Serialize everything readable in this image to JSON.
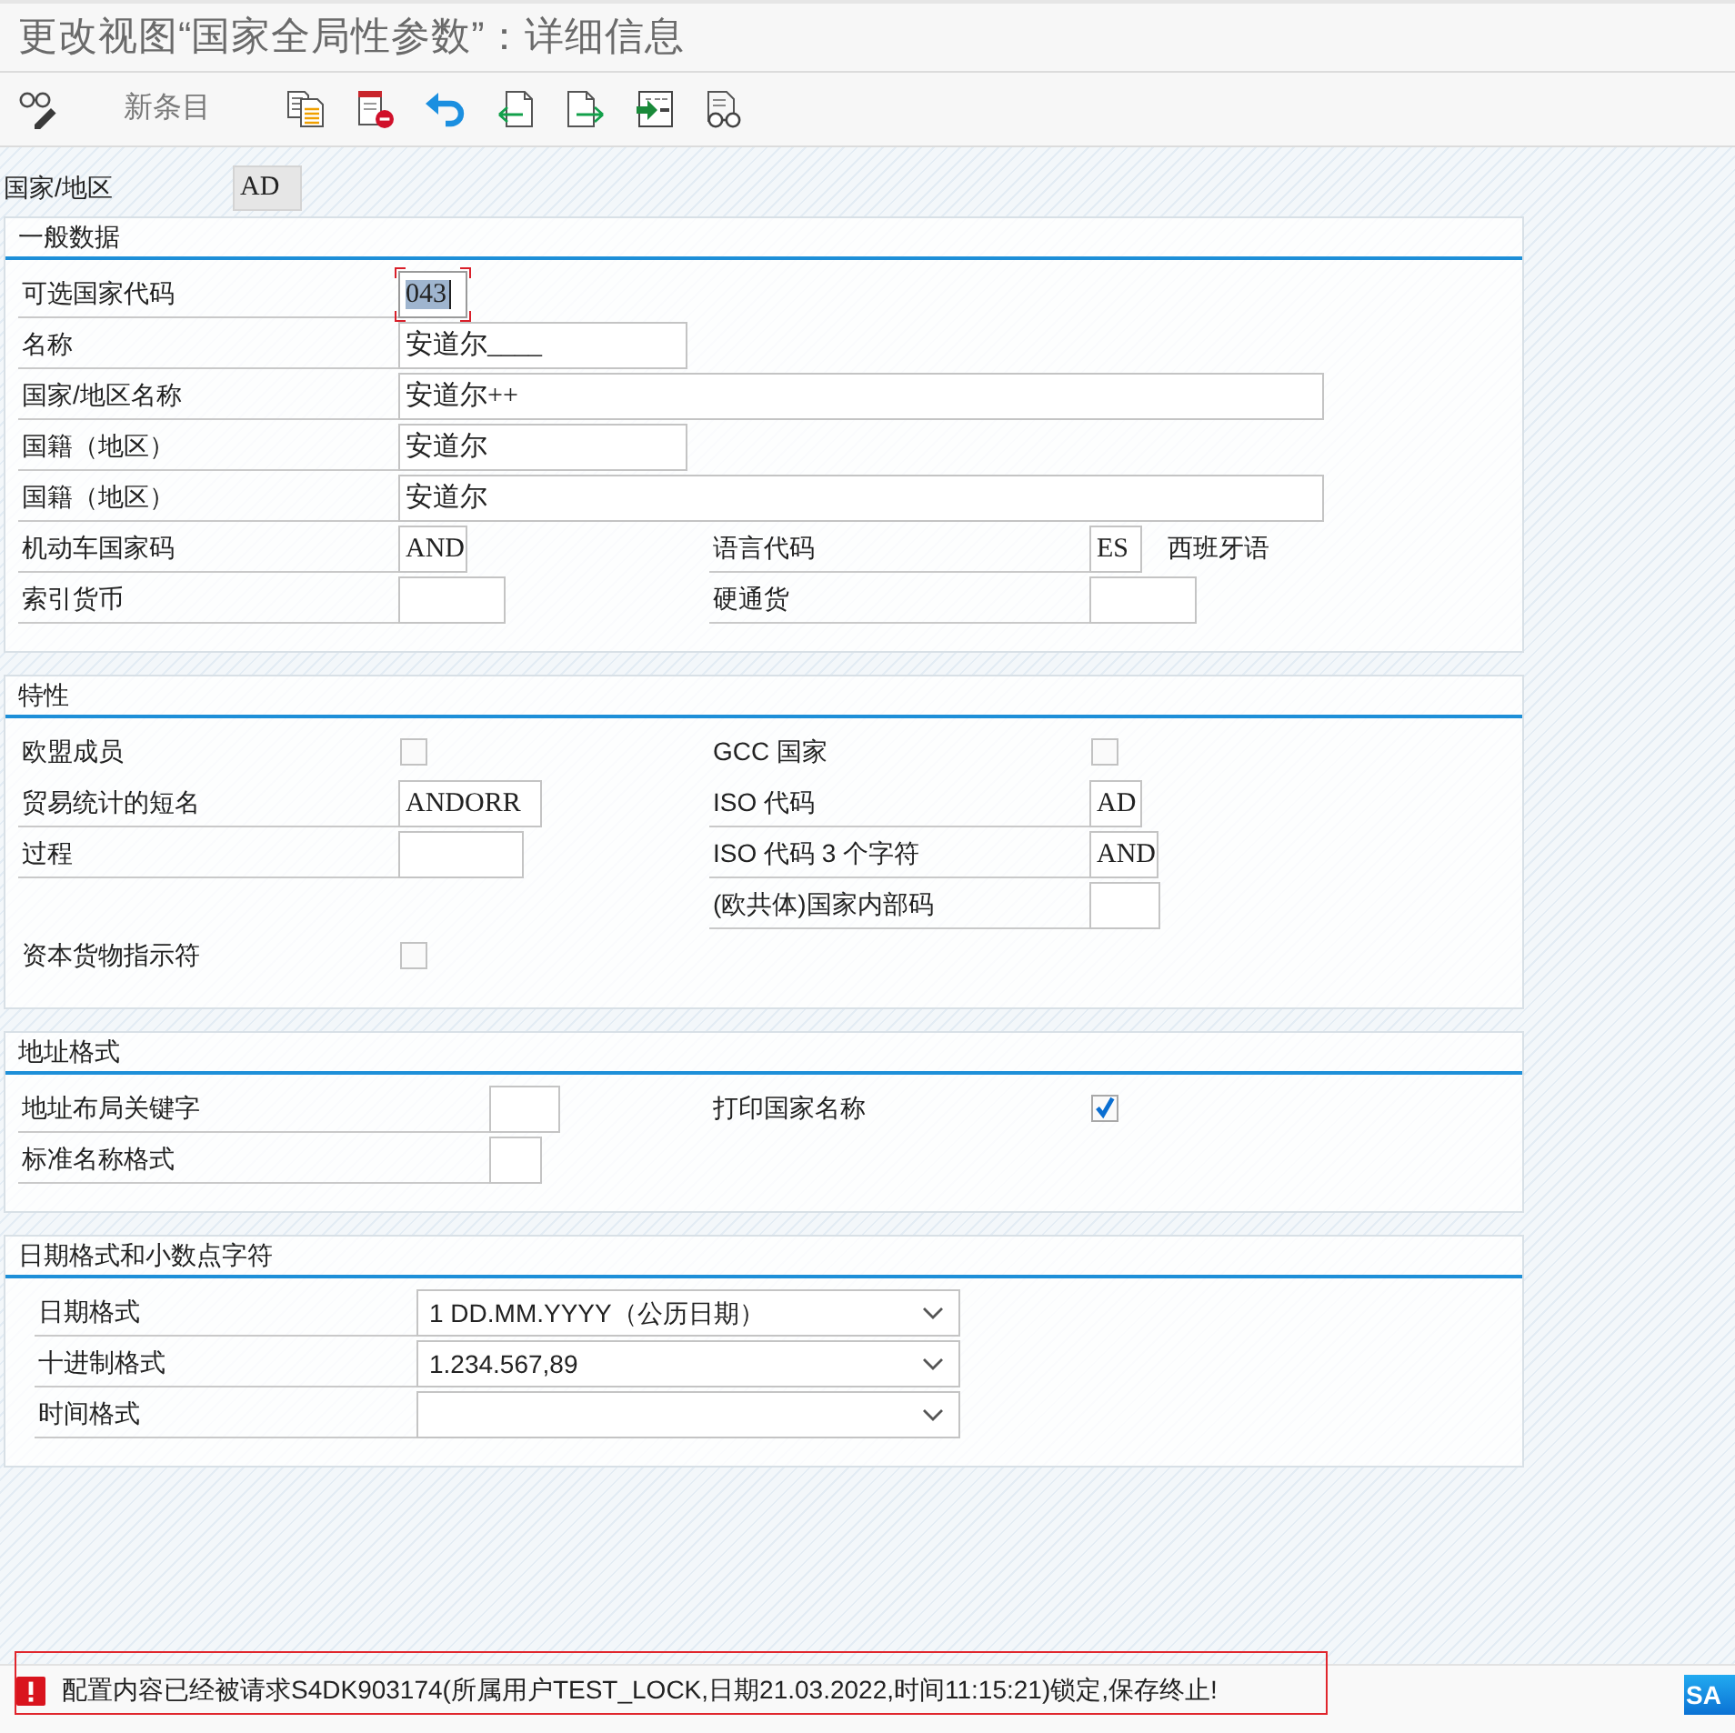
{
  "window": {
    "title": "更改视图“国家全局性参数”：详细信息"
  },
  "toolbar": {
    "new_entries": "新条目"
  },
  "key_field": {
    "label": "国家/地区",
    "value": "AD"
  },
  "groups": [
    {
      "title": "一般数据",
      "rows": [
        {
          "left": {
            "label": "可选国家代码",
            "kind": "input",
            "value": "043",
            "focused": true
          }
        },
        {
          "left": {
            "label": "名称",
            "kind": "input",
            "value": "安道尔____",
            "focused": false
          }
        },
        {
          "left": {
            "label": "国家/地区名称",
            "kind": "input",
            "value": "安道尔++",
            "focused": false
          }
        },
        {
          "left": {
            "label": "国籍（地区）",
            "kind": "input",
            "value": "安道尔",
            "focused": false
          }
        },
        {
          "left": {
            "label": "国籍（地区）",
            "kind": "input",
            "value": "安道尔",
            "focused": false
          }
        },
        {
          "left": {
            "label": "机动车国家码",
            "kind": "input",
            "value": "AND",
            "focused": false
          },
          "right": {
            "label": "语言代码",
            "kind": "input",
            "value": "ES",
            "focused": false,
            "description": "西班牙语"
          }
        },
        {
          "left": {
            "label": "索引货币",
            "kind": "input",
            "focused": false
          },
          "right": {
            "label": "硬通货",
            "kind": "input",
            "focused": false
          }
        }
      ]
    },
    {
      "title": "特性",
      "rows": [
        {
          "left": {
            "label": "欧盟成员",
            "kind": "checkbox",
            "checked": false
          },
          "right": {
            "label": "GCC 国家",
            "kind": "checkbox",
            "checked": false
          }
        },
        {
          "left": {
            "label": "贸易统计的短名",
            "kind": "input",
            "value": "ANDORR",
            "focused": false
          },
          "right": {
            "label": "ISO 代码",
            "kind": "input",
            "value": "AD",
            "focused": false
          }
        },
        {
          "left": {
            "label": "过程",
            "kind": "input",
            "focused": false
          },
          "right": {
            "label": "ISO 代码 3 个字符",
            "kind": "input",
            "value": "AND",
            "focused": false
          }
        },
        {
          "right": {
            "label": "(欧共体)国家内部码",
            "kind": "input",
            "focused": false
          }
        },
        {
          "left": {
            "label": "资本货物指示符",
            "kind": "checkbox",
            "checked": false
          }
        }
      ]
    },
    {
      "title": "地址格式",
      "rows": [
        {
          "left": {
            "label": "地址布局关键字",
            "kind": "input",
            "focused": false
          },
          "right": {
            "label": "打印国家名称",
            "kind": "checkbox",
            "checked": true
          }
        },
        {
          "left": {
            "label": "标准名称格式",
            "kind": "input",
            "focused": false
          }
        }
      ]
    },
    {
      "title": "日期格式和小数点字符",
      "rows": [
        {
          "left": {
            "label": "日期格式",
            "kind": "select",
            "value": "1 DD.MM.YYYY（公历日期）"
          }
        },
        {
          "left": {
            "label": "十进制格式",
            "kind": "select",
            "value": "1.234.567,89"
          }
        },
        {
          "left": {
            "label": "时间格式",
            "kind": "select"
          }
        }
      ]
    }
  ],
  "status_bar": {
    "kind": "error",
    "message": "配置内容已经被请求S4DK903174(所属用户TEST_LOCK,日期21.03.2022,时间11:15:21)锁定,保存终止!",
    "highlighted": true,
    "logo": "SA"
  }
}
